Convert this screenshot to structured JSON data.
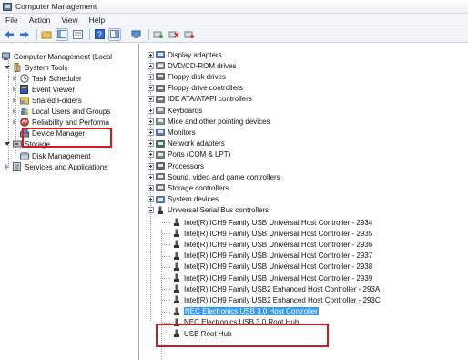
{
  "window": {
    "title": "Computer Management"
  },
  "menu": [
    "File",
    "Action",
    "View",
    "Help"
  ],
  "toolbar": [
    "back-arrow-icon",
    "forward-arrow-icon",
    "up-folder-icon",
    "show-hide-tree-icon",
    "properties-icon",
    "help-icon",
    "view-icon",
    "device-manager-icon",
    "scan-hardware-icon",
    "uninstall-icon",
    "disable-icon",
    "enable-icon"
  ],
  "left_tree": {
    "root": "Computer Management (Local",
    "system_tools": "System Tools",
    "task_scheduler": "Task Scheduler",
    "event_viewer": "Event Viewer",
    "shared_folders": "Shared Folders",
    "local_users": "Local Users and Groups",
    "reliability": "Reliability and Performa",
    "device_manager": "Device Manager",
    "storage": "Storage",
    "disk_management": "Disk Management",
    "services_apps": "Services and Applications"
  },
  "device_tree": {
    "categories": [
      "Display adapters",
      "DVD/CD-ROM drives",
      "Floppy disk drives",
      "Floppy drive controllers",
      "IDE ATA/ATAPI controllers",
      "Keyboards",
      "Mice and other pointing devices",
      "Monitors",
      "Network adapters",
      "Ports (COM & LPT)",
      "Processors",
      "Sound, video and game controllers",
      "Storage controllers",
      "System devices",
      "Universal Serial Bus controllers"
    ],
    "usb_children": [
      "Intel(R) ICH9 Family USB Universal Host Controller - 2934",
      "Intel(R) ICH9 Family USB Universal Host Controller - 2935",
      "Intel(R) ICH9 Family USB Universal Host Controller - 2936",
      "Intel(R) ICH9 Family USB Universal Host Controller - 2937",
      "Intel(R) ICH9 Family USB Universal Host Controller - 2938",
      "Intel(R) ICH9 Family USB Universal Host Controller - 2939",
      "Intel(R) ICH9 Family USB2 Enhanced Host Controller - 293A",
      "Intel(R) ICH9 Family USB2 Enhanced Host Controller - 293C",
      "NEC Electronics USB 3.0 Host Controller",
      "NEC Electronics USB 3.0 Root Hub",
      "USB Root Hub"
    ]
  },
  "colors": {
    "highlight_red": "#d7191c",
    "selection_blue": "#3399ff"
  }
}
